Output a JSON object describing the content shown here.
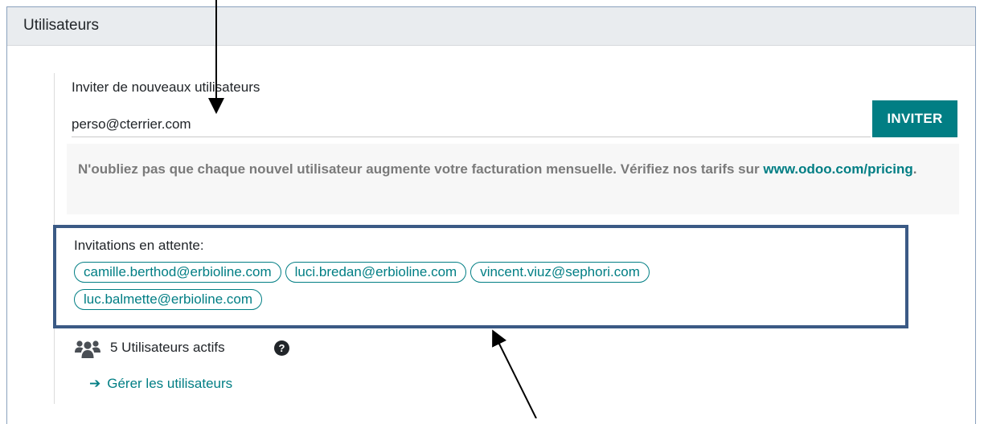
{
  "section": {
    "title": "Utilisateurs"
  },
  "invite": {
    "label": "Inviter de nouveaux utilisateurs",
    "input_value": "perso@cterrier.com",
    "button_label": "INVITER",
    "notice_text": "N'oubliez pas que chaque nouvel utilisateur augmente votre facturation mensuelle. Vérifiez nos tarifs sur",
    "notice_link": "www.odoo.com/pricing",
    "notice_end": "."
  },
  "pending": {
    "label": "Invitations en attente:",
    "emails": [
      "camille.berthod@erbioline.com",
      "luci.bredan@erbioline.com",
      "vincent.viuz@sephori.com",
      "luc.balmette@erbioline.com"
    ]
  },
  "users": {
    "count_text": "5 Utilisateurs actifs",
    "help_glyph": "?",
    "manage_arrow": "➔",
    "manage_label": "Gérer les utilisateurs"
  },
  "icons": {
    "users": "users-icon",
    "help": "question-circle-icon",
    "arrow": "arrow-right-icon"
  },
  "colors": {
    "accent": "#017e84",
    "header_bg": "#e9ecef",
    "highlight_border": "#3b5a85",
    "muted_text": "#7a7a7a"
  }
}
